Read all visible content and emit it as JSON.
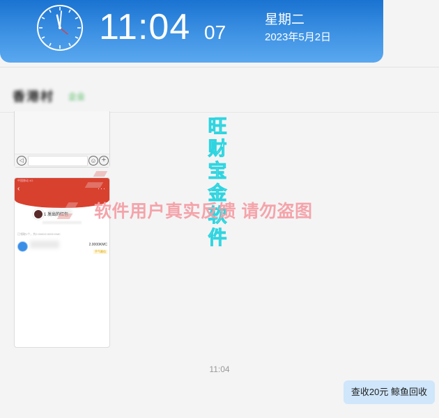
{
  "clock": {
    "hours_minutes": "11:04",
    "seconds": "07",
    "weekday": "星期二",
    "date": "2023年5月2日",
    "face_icon": "analog-clock-icon",
    "colors": {
      "banner_top": "#1a73d1",
      "banner_bottom": "#5aa8ef"
    }
  },
  "chat": {
    "contact_name": "香港村",
    "contact_tag": "企业",
    "screenshot_2": {
      "status_bar": "中国移动 4G",
      "sender": "1",
      "sender_suffix": "发出的红包",
      "received_summary": "已领取1个，共2.0000/2.0000 KMC",
      "amount": "2.0000KMC",
      "best_luck": "手气最佳"
    },
    "message_time": "11:04",
    "bubble_text": "查收20元  鲸鱼回收"
  },
  "watermarks": {
    "vertical_chars": [
      "旺",
      "财",
      "宝",
      "金",
      "软",
      "件"
    ],
    "horizontal": "软件用户真实反馈  请勿盗图"
  }
}
